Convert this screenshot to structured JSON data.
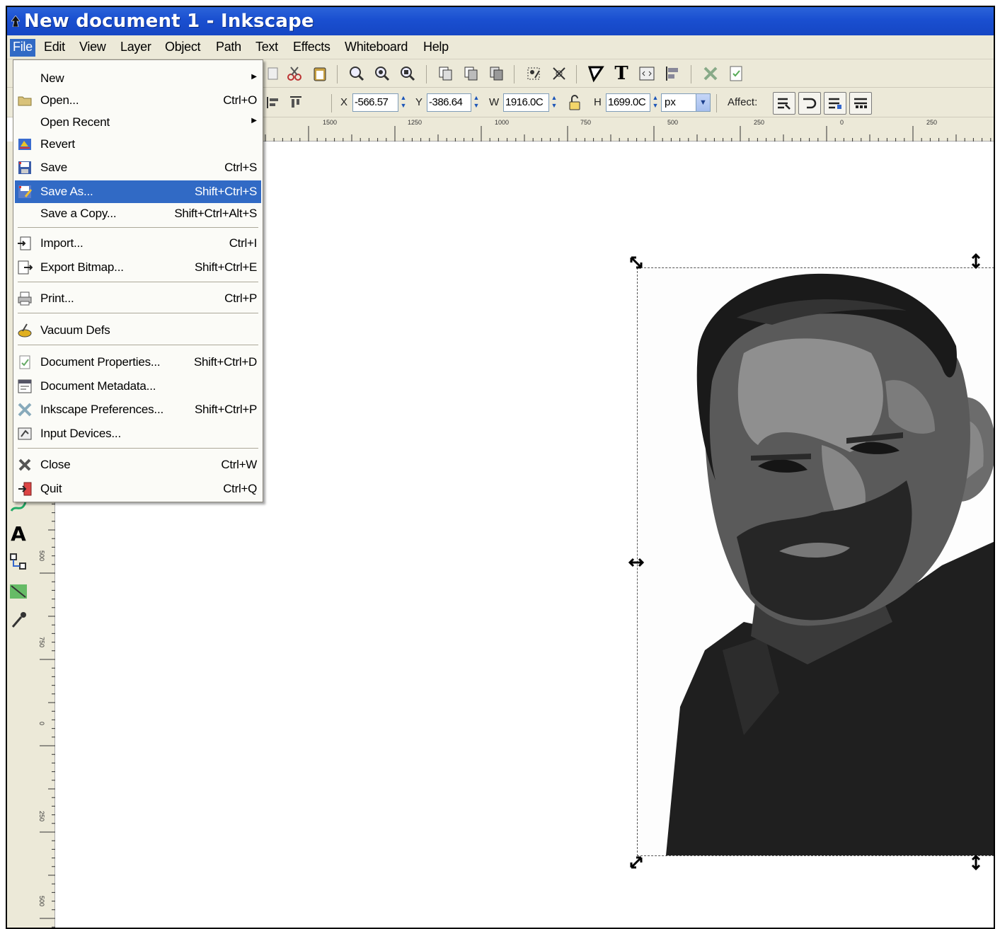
{
  "window": {
    "title": "New document 1 - Inkscape"
  },
  "menubar": {
    "items": [
      {
        "label": "File"
      },
      {
        "label": "Edit"
      },
      {
        "label": "View"
      },
      {
        "label": "Layer"
      },
      {
        "label": "Object"
      },
      {
        "label": "Path"
      },
      {
        "label": "Text"
      },
      {
        "label": "Effects"
      },
      {
        "label": "Whiteboard"
      },
      {
        "label": "Help"
      }
    ],
    "active": "File"
  },
  "toolbar": {
    "x_label": "X",
    "x_value": "-566.57",
    "y_label": "Y",
    "y_value": "-386.64",
    "w_label": "W",
    "w_value": "1916.0C",
    "h_label": "H",
    "h_value": "1699.0C",
    "unit": "px",
    "affect_label": "Affect:"
  },
  "ruler": {
    "horizontal_labels": [
      "1500",
      "1250",
      "1000",
      "750",
      "500",
      "250",
      "0",
      "250"
    ],
    "vertical_labels": [
      "500",
      "750",
      "0",
      "250",
      "500"
    ]
  },
  "file_menu": {
    "items": [
      {
        "label": "New",
        "shortcut": "",
        "submenu": true,
        "icon": "none"
      },
      {
        "label": "Open...",
        "shortcut": "Ctrl+O",
        "icon": "folder-open-icon"
      },
      {
        "label": "Open Recent",
        "shortcut": "",
        "submenu": true,
        "icon": "none"
      },
      {
        "label": "Revert",
        "shortcut": "",
        "icon": "revert-icon"
      },
      {
        "label": "Save",
        "shortcut": "Ctrl+S",
        "icon": "save-icon"
      },
      {
        "label": "Save As...",
        "shortcut": "Shift+Ctrl+S",
        "icon": "save-as-icon",
        "highlighted": true
      },
      {
        "label": "Save a Copy...",
        "shortcut": "Shift+Ctrl+Alt+S",
        "icon": "none"
      },
      {
        "label": "Import...",
        "shortcut": "Ctrl+I",
        "icon": "import-icon"
      },
      {
        "label": "Export Bitmap...",
        "shortcut": "Shift+Ctrl+E",
        "icon": "export-bitmap-icon"
      },
      {
        "label": "Print...",
        "shortcut": "Ctrl+P",
        "icon": "print-icon"
      },
      {
        "label": "Vacuum Defs",
        "shortcut": "",
        "icon": "vacuum-icon"
      },
      {
        "label": "Document Properties...",
        "shortcut": "Shift+Ctrl+D",
        "icon": "document-properties-icon"
      },
      {
        "label": "Document Metadata...",
        "shortcut": "",
        "icon": "document-metadata-icon"
      },
      {
        "label": "Inkscape Preferences...",
        "shortcut": "Shift+Ctrl+P",
        "icon": "preferences-icon"
      },
      {
        "label": "Input Devices...",
        "shortcut": "",
        "icon": "input-devices-icon"
      },
      {
        "label": "Close",
        "shortcut": "Ctrl+W",
        "icon": "close-icon"
      },
      {
        "label": "Quit",
        "shortcut": "Ctrl+Q",
        "icon": "quit-icon"
      }
    ]
  },
  "colors": {
    "titlebar": "#1a4fd0",
    "menu_highlight": "#316ac5",
    "chrome": "#ece9d8"
  }
}
